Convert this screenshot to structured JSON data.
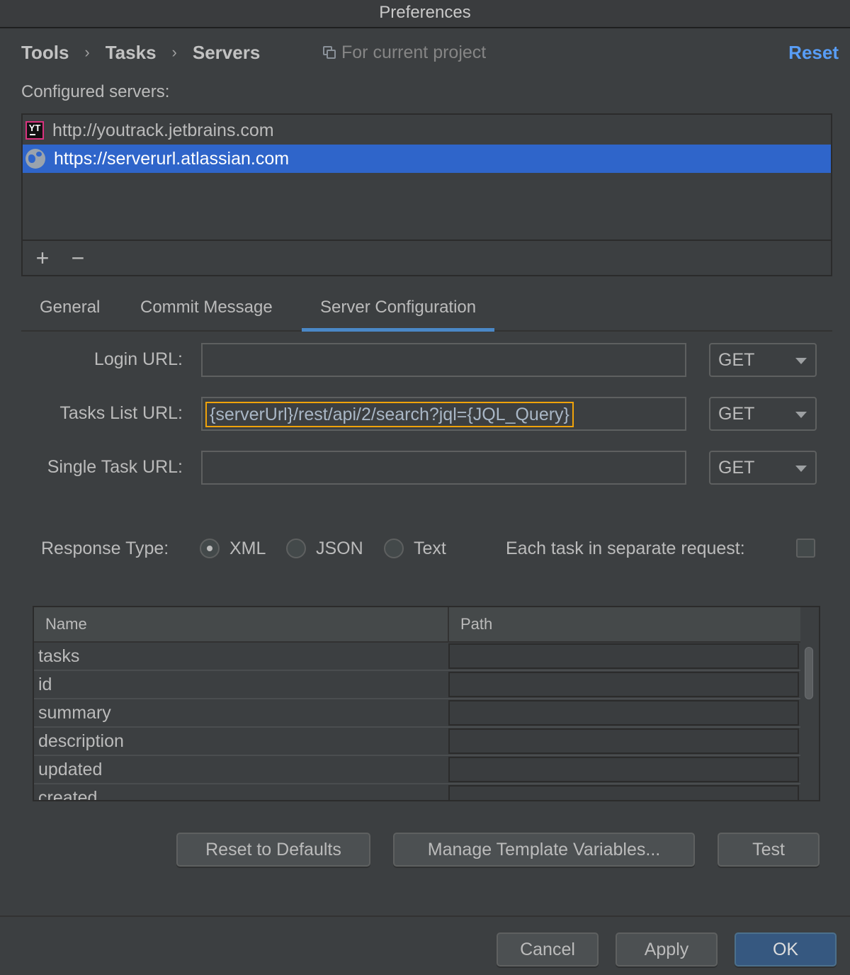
{
  "window": {
    "title": "Preferences"
  },
  "breadcrumb": [
    "Tools",
    "Tasks",
    "Servers"
  ],
  "scope_label": "For current project",
  "reset_label": "Reset",
  "configured_servers": {
    "label": "Configured servers:",
    "items": [
      {
        "url": "http://youtrack.jetbrains.com",
        "icon": "youtrack-icon",
        "selected": false
      },
      {
        "url": "https://serverurl.atlassian.com",
        "icon": "globe-icon",
        "selected": true
      }
    ],
    "toolbar": {
      "add": "+",
      "remove": "−"
    }
  },
  "tabs": [
    {
      "label": "General",
      "active": false
    },
    {
      "label": "Commit Message",
      "active": false
    },
    {
      "label": "Server Configuration",
      "active": true
    }
  ],
  "fields": [
    {
      "label": "Login URL:",
      "value": "",
      "method": "GET"
    },
    {
      "label": "Tasks List URL:",
      "value": "{serverUrl}/rest/api/2/search?jql={JQL_Query}",
      "method": "GET"
    },
    {
      "label": "Single Task URL:",
      "value": "",
      "method": "GET"
    }
  ],
  "response_type": {
    "label": "Response Type:",
    "options": [
      "XML",
      "JSON",
      "Text"
    ],
    "selected": "XML"
  },
  "separate_request": {
    "label": "Each task in separate request:",
    "checked": false
  },
  "table": {
    "columns": [
      "Name",
      "Path"
    ],
    "rows": [
      {
        "name": "tasks",
        "path": ""
      },
      {
        "name": "id",
        "path": ""
      },
      {
        "name": "summary",
        "path": ""
      },
      {
        "name": "description",
        "path": ""
      },
      {
        "name": "updated",
        "path": ""
      },
      {
        "name": "created",
        "path": ""
      }
    ]
  },
  "actions": {
    "reset_defaults": "Reset to Defaults",
    "manage_vars": "Manage Template Variables...",
    "test": "Test"
  },
  "footer": {
    "cancel": "Cancel",
    "apply": "Apply",
    "ok": "OK"
  }
}
